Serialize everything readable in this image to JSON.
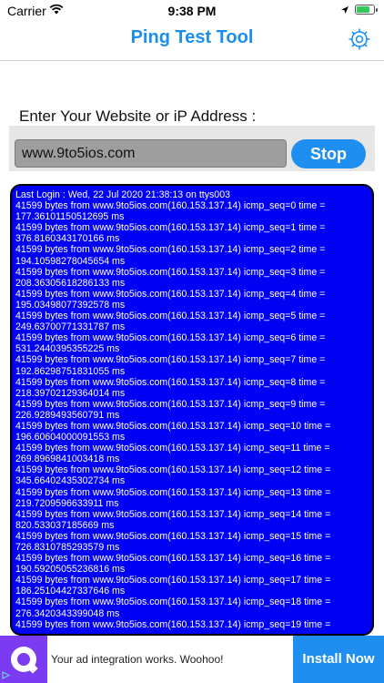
{
  "status": {
    "carrier": "Carrier",
    "time": "9:38 PM"
  },
  "nav": {
    "title": "Ping Test Tool",
    "settings_icon": "gear-icon"
  },
  "prompt": "Enter Your Website or iP Address :",
  "url_value": "www.9to5ios.com",
  "stop_label": "Stop",
  "colors": {
    "accent": "#1e8ff0",
    "console_bg": "#0000f2",
    "ad_logo": "#7b3bf1"
  },
  "console": {
    "lines": [
      "Last Login : Wed, 22 Jul 2020 21:38:13 on ttys003",
      "41599 bytes from www.9to5ios.com(160.153.137.14) icmp_seq=0 time =",
      "177.36101150512695 ms",
      "41599 bytes from www.9to5ios.com(160.153.137.14) icmp_seq=1 time =",
      "376.8160343170166 ms",
      "41599 bytes from www.9to5ios.com(160.153.137.14) icmp_seq=2 time =",
      "194.10598278045654 ms",
      "41599 bytes from www.9to5ios.com(160.153.137.14) icmp_seq=3 time =",
      "208.36305618286133 ms",
      "41599 bytes from www.9to5ios.com(160.153.137.14) icmp_seq=4 time =",
      "195.03498077392578 ms",
      "41599 bytes from www.9to5ios.com(160.153.137.14) icmp_seq=5 time =",
      "249.63700771331787 ms",
      "41599 bytes from www.9to5ios.com(160.153.137.14) icmp_seq=6 time =",
      "531.2440395355225 ms",
      "41599 bytes from www.9to5ios.com(160.153.137.14) icmp_seq=7 time =",
      "192.86298751831055 ms",
      "41599 bytes from www.9to5ios.com(160.153.137.14) icmp_seq=8 time =",
      "218.39702129364014 ms",
      "41599 bytes from www.9to5ios.com(160.153.137.14) icmp_seq=9 time =",
      "226.9289493560791 ms",
      "41599 bytes from www.9to5ios.com(160.153.137.14) icmp_seq=10 time =",
      "196.60604000091553 ms",
      "41599 bytes from www.9to5ios.com(160.153.137.14) icmp_seq=11 time =",
      "269.8969841003418 ms",
      "41599 bytes from www.9to5ios.com(160.153.137.14) icmp_seq=12 time =",
      "345.66402435302734 ms",
      "41599 bytes from www.9to5ios.com(160.153.137.14) icmp_seq=13 time =",
      "219.7209596633911 ms",
      "41599 bytes from www.9to5ios.com(160.153.137.14) icmp_seq=14 time =",
      "820.533037185669 ms",
      "41599 bytes from www.9to5ios.com(160.153.137.14) icmp_seq=15 time =",
      "726.8310785293579 ms",
      "41599 bytes from www.9to5ios.com(160.153.137.14) icmp_seq=16 time =",
      "190.59205055236816 ms",
      "41599 bytes from www.9to5ios.com(160.153.137.14) icmp_seq=17 time =",
      "186.25104427337646 ms",
      "41599 bytes from www.9to5ios.com(160.153.137.14) icmp_seq=18 time =",
      "276.3420343399048 ms",
      "41599 bytes from www.9to5ios.com(160.153.137.14) icmp_seq=19 time ="
    ]
  },
  "ad": {
    "text": "Your ad integration works. Woohoo!",
    "install_label": "Install Now"
  }
}
